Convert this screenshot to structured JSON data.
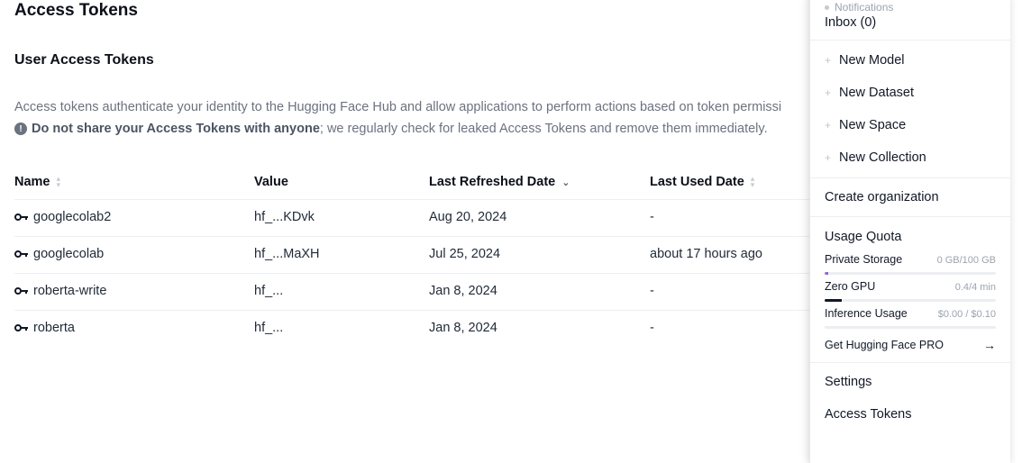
{
  "page": {
    "title": "Access Tokens",
    "section_title": "User Access Tokens",
    "description": "Access tokens authenticate your identity to the Hugging Face Hub and allow applications to perform actions based on token permissi",
    "warning_bold": "Do not share your Access Tokens with anyone",
    "warning_rest": "; we regularly check for leaked Access Tokens and remove them immediately.",
    "warning_icon": "info-circle-icon"
  },
  "table": {
    "headers": {
      "name": "Name",
      "value": "Value",
      "last_refreshed": "Last Refreshed Date",
      "last_used": "Last Used Date"
    },
    "rows": [
      {
        "name": "googlecolab2",
        "value": "hf_...KDvk",
        "refreshed": "Aug 20, 2024",
        "used": "-"
      },
      {
        "name": "googlecolab",
        "value": "hf_...MaXH",
        "refreshed": "Jul 25, 2024",
        "used": "about 17 hours ago"
      },
      {
        "name": "roberta-write",
        "value": "hf_...",
        "refreshed": "Jan 8, 2024",
        "used": "-"
      },
      {
        "name": "roberta",
        "value": "hf_...",
        "refreshed": "Jan 8, 2024",
        "used": "-"
      }
    ]
  },
  "dropdown": {
    "notifications_label": "Notifications",
    "inbox": "Inbox (0)",
    "new_items": [
      "New Model",
      "New Dataset",
      "New Space",
      "New Collection"
    ],
    "create_org": "Create organization",
    "usage_quota": "Usage Quota",
    "quotas": [
      {
        "name": "Private Storage",
        "value": "0 GB/100 GB",
        "fill_percent": 2,
        "color": "#f97316",
        "gradient": true
      },
      {
        "name": "Zero GPU",
        "value": "0.4/4 min",
        "fill_percent": 10,
        "color": "#111827",
        "gradient": false
      },
      {
        "name": "Inference Usage",
        "value": "$0.00 / $0.10",
        "fill_percent": 0,
        "color": "#111827",
        "gradient": false
      }
    ],
    "get_pro": "Get Hugging Face PRO",
    "settings": "Settings",
    "access_tokens": "Access Tokens"
  },
  "colors": {
    "text_primary": "#111827",
    "text_muted": "#6b7280",
    "divider": "#eceef1"
  }
}
